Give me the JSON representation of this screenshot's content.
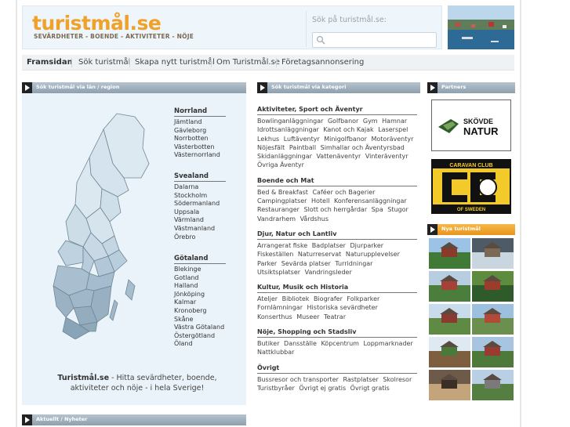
{
  "site": {
    "logo": "turistmål.se",
    "tagline": "SEVÄRDHETER - BOENDE - AKTIVITETER - NÖJE"
  },
  "search": {
    "label": "Sök på turistmål.se:",
    "placeholder": ""
  },
  "nav": [
    "Framsidan",
    "Sök turistmål",
    "Skapa nytt turistmål",
    "Om Turistmål.se",
    "Företagsannonsering"
  ],
  "panels": {
    "map_title": "Sök turistmål via län / region",
    "category_title": "Sök turistmål via kategori",
    "partners_title": "Partners",
    "new_title": "Nya turistmål",
    "news_title": "Aktuellt / Nyheter"
  },
  "regions": [
    {
      "name": "Norrland",
      "items": [
        "Jämtland",
        "Gävleborg",
        "Norrbotten",
        "Västerbotten",
        "Västernorrland"
      ]
    },
    {
      "name": "Svealand",
      "items": [
        "Dalarna",
        "Stockholm",
        "Södermanland",
        "Uppsala",
        "Värmland",
        "Västmanland",
        "Örebro"
      ]
    },
    {
      "name": "Götaland",
      "items": [
        "Blekinge",
        "Gotland",
        "Halland",
        "Jönköping",
        "Kalmar",
        "Kronoberg",
        "Skåne",
        "Västra Götaland",
        "Östergötland",
        "Öland"
      ]
    }
  ],
  "intro": {
    "brand": "Turistmål.se",
    "text": " - Hitta sevärdheter, boende, aktiviteter och nöje - i hela Sverige!"
  },
  "categories": [
    {
      "name": "Aktiviteter, Sport och Äventyr",
      "links": [
        "Bowlinganläggningar",
        "Golfbanor",
        "Gym",
        "Hamnar",
        "Idrottsanläggningar",
        "Kanot och Kajak",
        "Laserspel",
        "Lekhus",
        "Luftäventyr",
        "Minigolfbanor",
        "Motoräventyr",
        "Nöjesfält",
        "Paintball",
        "Simhallar och Äventyrsbad",
        "Skidanläggningar",
        "Vattenäventyr",
        "Vinteräventyr",
        "Övriga Äventyr"
      ]
    },
    {
      "name": "Boende och Mat",
      "links": [
        "Bed & Breakfast",
        "Caféer och Bagerier",
        "Campingplatser",
        "Hotell",
        "Konferensanläggningar",
        "Restauranger",
        "Slott och herrgårdar",
        "Spa",
        "Stugor",
        "Vandrarhem",
        "Vårdshus"
      ]
    },
    {
      "name": "Djur, Natur och Lantliv",
      "links": [
        "Arrangerat fiske",
        "Badplatser",
        "Djurparker",
        "Fiskeställen",
        "Naturreservat",
        "Naturupplevelser",
        "Parker",
        "Sevärda platser",
        "Turridningar",
        "Utsiktsplatser",
        "Vandringsleder"
      ]
    },
    {
      "name": "Kultur, Musik och Historia",
      "links": [
        "Ateljer",
        "Bibliotek",
        "Biografer",
        "Folkparker",
        "Fornlämningar",
        "Historiska sevärdheter",
        "Konserthus",
        "Museer",
        "Teatrar"
      ]
    },
    {
      "name": "Nöje, Shopping och Stadsliv",
      "links": [
        "Butiker",
        "Dansställe",
        "Köpcentrum",
        "Loppmarknader",
        "Nattklubbar"
      ]
    },
    {
      "name": "Övrigt",
      "links": [
        "Bussresor och transporter",
        "Rastplatser",
        "Skolresor",
        "Turistbyråer",
        "Övrigt ej gratis",
        "Övrigt gratis"
      ]
    }
  ],
  "partners": [
    {
      "name": "SKÖVDE NATUR"
    },
    {
      "top": "CARAVAN CLUB",
      "bottom": "OF SWEDEN"
    }
  ],
  "colors": {
    "logo": "#f0a12a",
    "bar": "#98a8b6",
    "map_bg": "#eaf3f9",
    "new_bar": "#f0a030"
  }
}
